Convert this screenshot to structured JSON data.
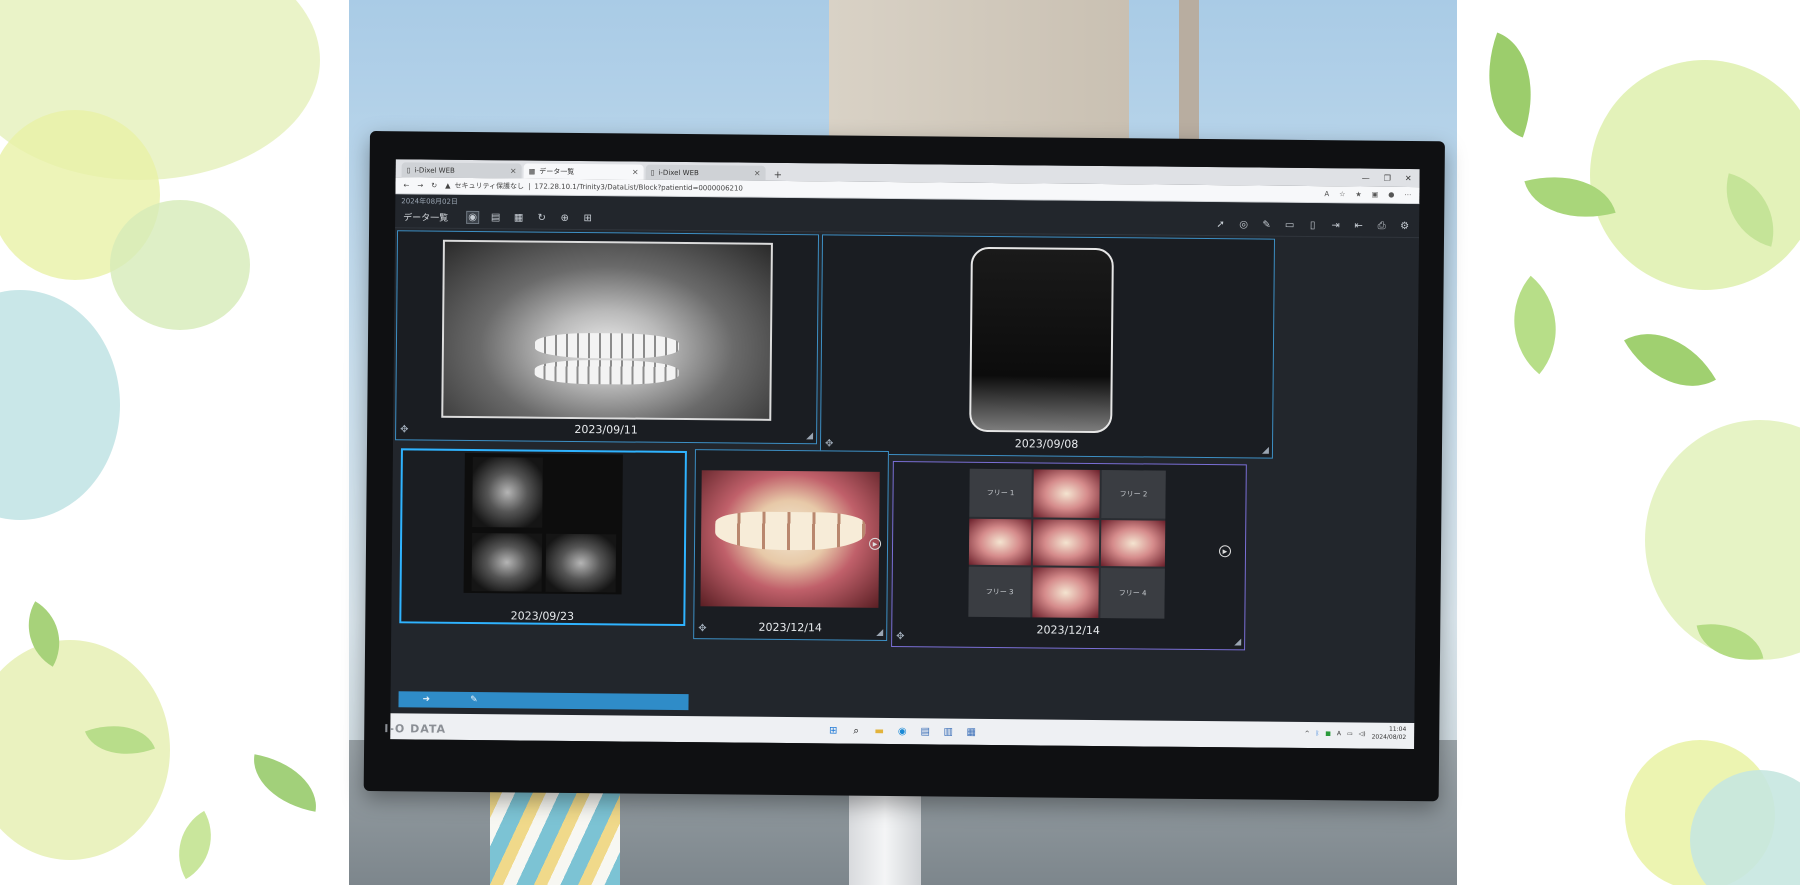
{
  "browser": {
    "tabs": [
      {
        "label": "i-Dixel WEB"
      },
      {
        "label": "データ一覧"
      },
      {
        "label": "i-Dixel WEB"
      }
    ],
    "active_tab_index": 1,
    "security_label": "セキュリティ保護なし",
    "url": "172.28.10.1/Trinity3/DataList/Block?patientid=0000006210"
  },
  "app": {
    "date_header": "2024年08月02日",
    "title": "データ一覧"
  },
  "panels": [
    {
      "date": "2023/09/11"
    },
    {
      "date": "2023/09/08"
    },
    {
      "date": "2023/09/23"
    },
    {
      "date": "2023/12/14"
    },
    {
      "date": "2023/12/14"
    }
  ],
  "collage_labels": [
    "フリー 1",
    "フリー 2",
    "フリー 3",
    "フリー 4"
  ],
  "monitor_brand": "I-O DATA",
  "taskbar": {
    "time": "11:04",
    "date": "2024/08/02"
  },
  "colors": {
    "panel_border": "#3d8fc4",
    "selected_panel_border": "#2fb3ff",
    "status_bar": "#2f8cc8",
    "collage_border": "#7a6fd6"
  }
}
